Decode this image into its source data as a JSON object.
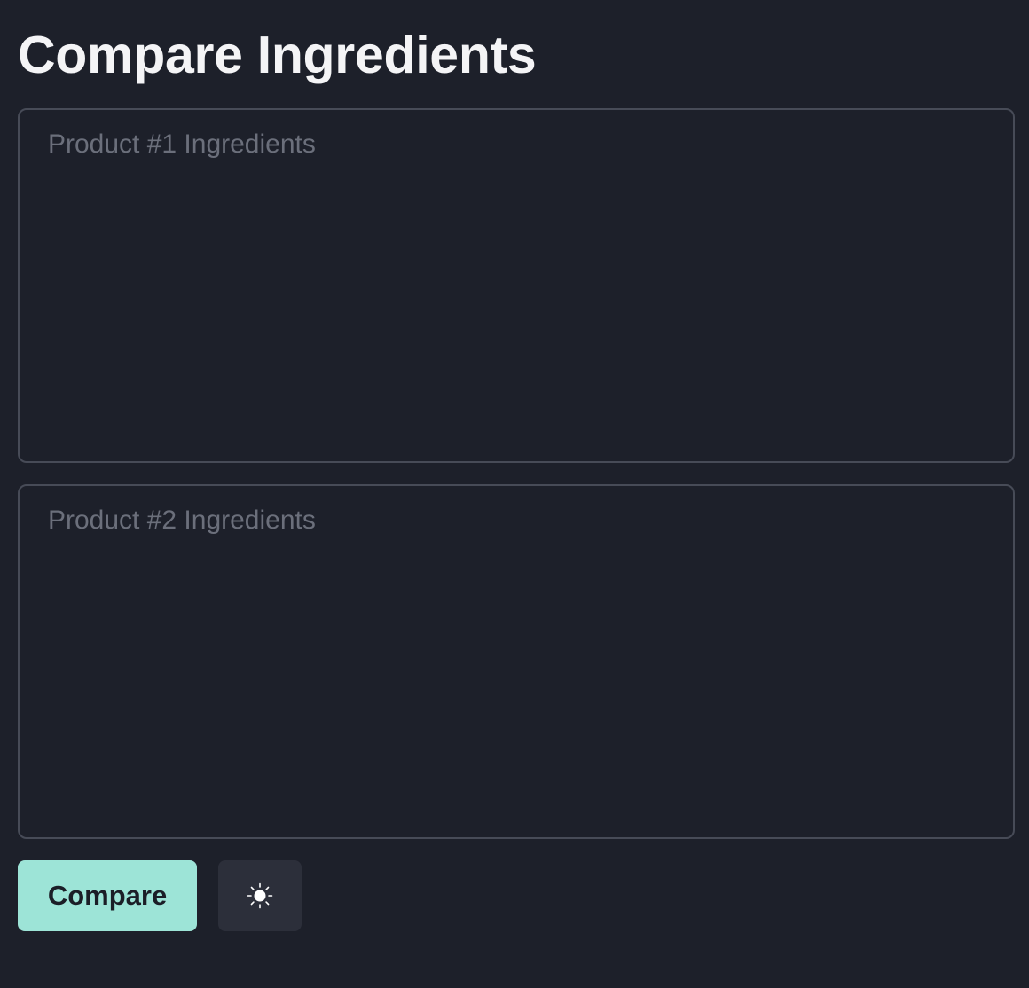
{
  "header": {
    "title": "Compare Ingredients"
  },
  "inputs": {
    "product1": {
      "value": "",
      "placeholder": "Product #1 Ingredients"
    },
    "product2": {
      "value": "",
      "placeholder": "Product #2 Ingredients"
    }
  },
  "actions": {
    "compare_label": "Compare",
    "theme_toggle_icon": "sun-icon"
  },
  "colors": {
    "background": "#1d202a",
    "accent": "#9de4d7",
    "input_border": "#474b57",
    "secondary_button": "#2c2f3a"
  }
}
